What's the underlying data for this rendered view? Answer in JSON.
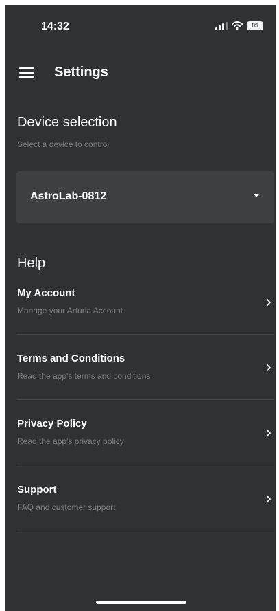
{
  "status_bar": {
    "time": "14:32",
    "battery_level": "85"
  },
  "header": {
    "title": "Settings",
    "menu_icon": "menu-icon"
  },
  "device_selection": {
    "title": "Device selection",
    "subtitle": "Select a device to control",
    "selected_device": "AstroLab-0812"
  },
  "help": {
    "title": "Help",
    "items": [
      {
        "title": "My Account",
        "subtitle": "Manage your Arturia Account"
      },
      {
        "title": "Terms and Conditions",
        "subtitle": "Read the app's terms and conditions"
      },
      {
        "title": "Privacy Policy",
        "subtitle": "Read the app's privacy policy"
      },
      {
        "title": "Support",
        "subtitle": "FAQ and customer support"
      }
    ]
  },
  "colors": {
    "background": "#2f3133",
    "panel": "#3d3f42",
    "text_primary": "#ffffff",
    "text_secondary": "#7d8185",
    "divider": "#45474a"
  }
}
